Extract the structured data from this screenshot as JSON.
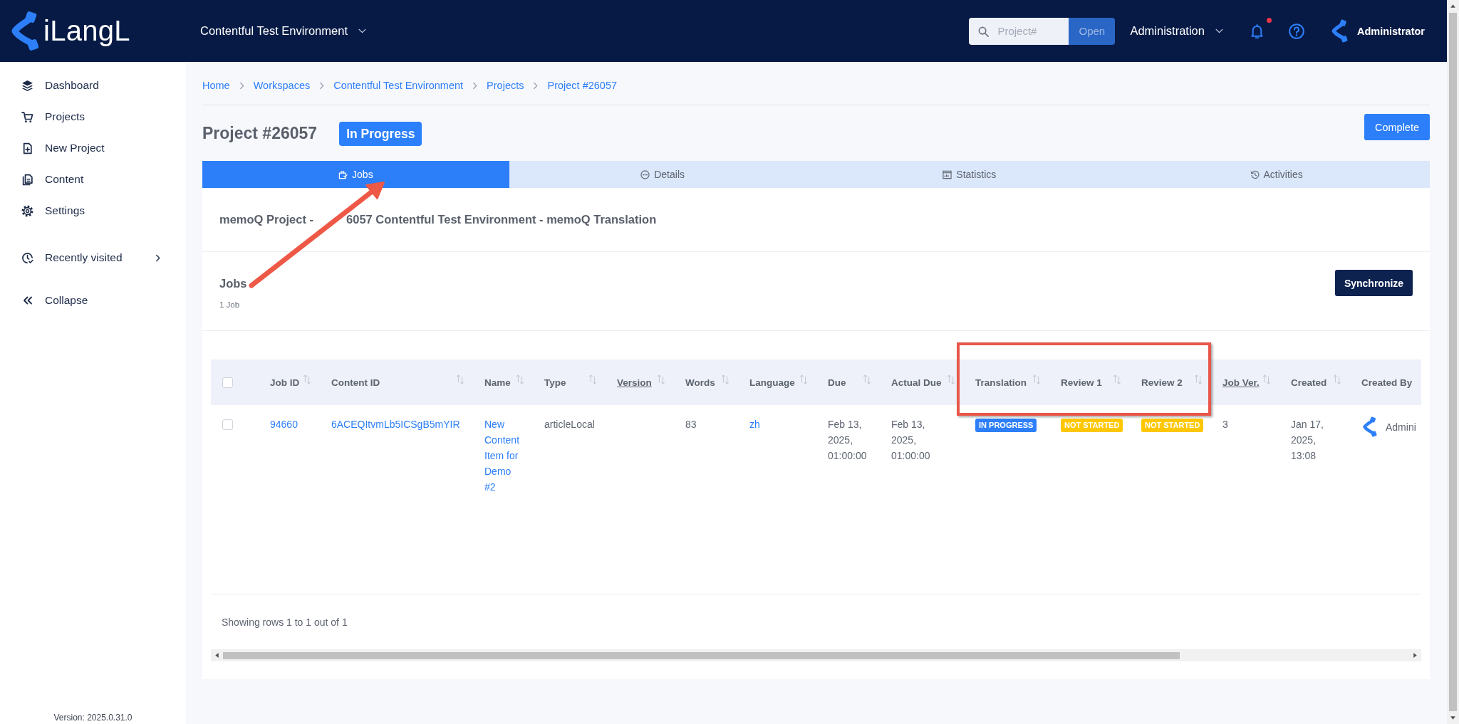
{
  "top_bar": {
    "logo_text": "iLangL",
    "workspace": "Contentful Test Environment",
    "search": {
      "placeholder": "Project#"
    },
    "open_button": {
      "label": "Open",
      "disabled": true
    },
    "admin_menu": "Administration",
    "notification_dot": true,
    "user": "Administrator"
  },
  "sidebar": {
    "items": [
      {
        "label": "Dashboard",
        "selected": false
      },
      {
        "label": "Projects",
        "selected": false
      },
      {
        "label": "New Project",
        "selected": false
      },
      {
        "label": "Content",
        "selected": false
      },
      {
        "label": "Settings",
        "selected": false
      }
    ],
    "recent": {
      "label": "Recently visited",
      "expanded": false
    },
    "collapse": "Collapse",
    "version": "Version: 2025.0.31.0"
  },
  "breadcrumb": [
    "Home",
    "Workspaces",
    "Contentful Test Environment",
    "Projects",
    "Project #26057"
  ],
  "project": {
    "title": "Project #26057",
    "status": "In Progress",
    "complete_button": "Complete"
  },
  "tabs": [
    {
      "label": "Jobs",
      "selected": true
    },
    {
      "label": "Details",
      "selected": false
    },
    {
      "label": "Statistics",
      "selected": false
    },
    {
      "label": "Activities",
      "selected": false
    }
  ],
  "card": {
    "heading_parts": [
      "memoQ Project -",
      "6057 Contentful Test Environment - memoQ Translation"
    ],
    "jobs_title": "Jobs",
    "jobs_count": "1 Job",
    "sync_button": "Synchronize"
  },
  "table": {
    "select_all": {
      "checked": false
    },
    "columns": [
      {
        "label": "Job ID",
        "sortable": true,
        "kind": "plain"
      },
      {
        "label": "Content ID",
        "sortable": true,
        "kind": "plain"
      },
      {
        "label": "Name",
        "sortable": true,
        "kind": "plain"
      },
      {
        "label": "Type",
        "sortable": true,
        "kind": "plain"
      },
      {
        "label": "Version",
        "sortable": true,
        "kind": "underlined"
      },
      {
        "label": "Words",
        "sortable": true,
        "kind": "plain"
      },
      {
        "label": "Language",
        "sortable": true,
        "kind": "plain"
      },
      {
        "label": "Due",
        "sortable": true,
        "kind": "plain"
      },
      {
        "label": "Actual Due",
        "sortable": true,
        "kind": "plain"
      },
      {
        "label": "Translation",
        "sortable": true,
        "kind": "plain"
      },
      {
        "label": "Review 1",
        "sortable": true,
        "kind": "plain"
      },
      {
        "label": "Review 2",
        "sortable": true,
        "kind": "plain"
      },
      {
        "label": "Job Ver.",
        "sortable": true,
        "kind": "underlined"
      },
      {
        "label": "Created",
        "sortable": true,
        "kind": "plain"
      },
      {
        "label": "Created By",
        "sortable": false,
        "kind": "plain"
      }
    ],
    "rows": [
      {
        "checked": false,
        "cells": [
          {
            "kind": "link",
            "text": "94660"
          },
          {
            "kind": "link",
            "text": "6ACEQItvmLb5ICSgB5mYIR"
          },
          {
            "kind": "link",
            "text": "New Content Item for Demo #2"
          },
          {
            "kind": "text",
            "text": "articleLocal"
          },
          {
            "kind": "empty"
          },
          {
            "kind": "text",
            "text": "83"
          },
          {
            "kind": "link",
            "text": "zh"
          },
          {
            "kind": "text",
            "text": "Feb 13, 2025, 01:00:00"
          },
          {
            "kind": "text",
            "text": "Feb 13, 2025, 01:00:00"
          },
          {
            "kind": "badge",
            "text": "IN PROGRESS",
            "color": "#2d7ff9"
          },
          {
            "kind": "badge",
            "text": "NOT STARTED",
            "color": "#ffc700"
          },
          {
            "kind": "badge",
            "text": "NOT STARTED",
            "color": "#ffc700"
          },
          {
            "kind": "text",
            "text": "3"
          },
          {
            "kind": "text",
            "text": "Jan 17, 2025, 13:08"
          },
          {
            "kind": "user",
            "text": "Admini"
          }
        ]
      }
    ],
    "footer": "Showing rows 1 to 1 out of 1"
  }
}
